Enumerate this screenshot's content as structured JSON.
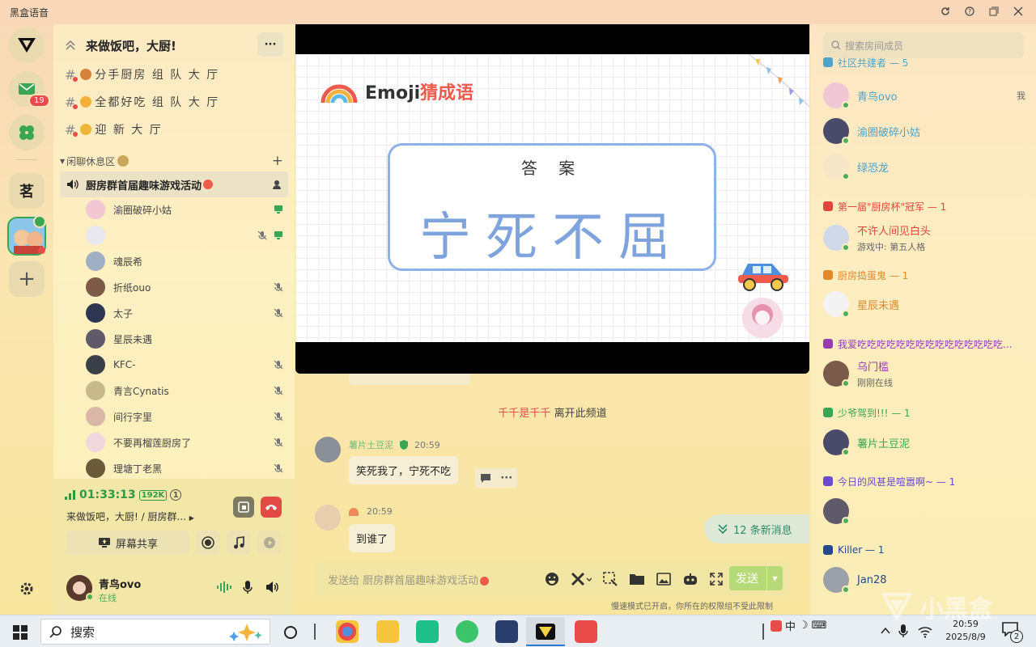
{
  "app": {
    "title": "黑盒语音"
  },
  "rail": {
    "mail_badge": "19",
    "tea_label": "茗",
    "add_label": "+"
  },
  "server": {
    "title": "来做饭吧，大厨!",
    "more_label": "···"
  },
  "text_channels": [
    {
      "name": "分手厨房 组 队 大 厅",
      "emoji_color": "#d7823a"
    },
    {
      "name": "全都好吃 组 队 大 厅",
      "emoji_color": "#f3b13a"
    },
    {
      "name": "迎 新 大 厅",
      "emoji_color": "#f0b437"
    }
  ],
  "group": {
    "name": "闲聊休息区",
    "add_label": "+"
  },
  "voice_channel": {
    "name": "厨房群首届趣味游戏活动"
  },
  "voice_members": [
    {
      "name": "渝圈破碎小姑",
      "muted": false,
      "color": "#f3c6d3"
    },
    {
      "name": "",
      "muted": true,
      "color": "#e8e8ee"
    },
    {
      "name": "魂辰希",
      "muted": false,
      "color": "#9fb0c4"
    },
    {
      "name": "折纸ouo",
      "muted": true,
      "color": "#7c5a45"
    },
    {
      "name": "太子",
      "muted": true,
      "color": "#2d3550"
    },
    {
      "name": "星辰未遇",
      "muted": false,
      "color": "#5e5a6a"
    },
    {
      "name": "KFC-",
      "muted": true,
      "color": "#3b4048"
    },
    {
      "name": "青言Cynatis",
      "muted": true,
      "color": "#c8b98a"
    },
    {
      "name": "间行字里",
      "muted": true,
      "color": "#d9b6a6"
    },
    {
      "name": "不要再榴莲厨房了",
      "muted": true,
      "color": "#f1d7de"
    },
    {
      "name": "理塘丁老黑",
      "muted": true,
      "color": "#6a5a3a"
    }
  ],
  "call": {
    "duration": "01:33:13",
    "bitrate": "192K",
    "count": "1",
    "channel": "来做饭吧，大厨! / 厨房群...",
    "screen_share_label": "屏幕共享"
  },
  "user": {
    "name": "青鸟ovo",
    "status": "在线"
  },
  "slide": {
    "logo_emoji": "Emoji",
    "logo_word": "猜成语",
    "answer_label": "答 案",
    "idiom": "宁死不屈"
  },
  "chat": {
    "system": {
      "user": "千千是千千",
      "text": "离开此频道"
    },
    "messages": [
      {
        "nick": "薯片土豆泥",
        "time": "20:59",
        "text": "笑死我了，宁死不吃"
      },
      {
        "nick": "",
        "time": "20:59",
        "text": "到谁了"
      }
    ],
    "new_messages": "12 条新消息",
    "input_placeholder": "发送给 厨房群首届趣味游戏活动",
    "send_label": "发送",
    "slow_mode": "慢速模式已开启，你所在的权限组不受此限制"
  },
  "members_panel": {
    "search_placeholder": "搜索房间成员",
    "top_partial_role": "社区共建者 — 5",
    "me_label": "我",
    "roles": [
      {
        "name": "第一届\"厨房杯\"冠军 — 1",
        "color": "#e0473a"
      },
      {
        "name": "厨房捣蛋鬼 — 1",
        "color": "#e0892f"
      },
      {
        "name": "我爱吃吃吃吃吃吃吃吃吃吃吃吃吃吃吃...",
        "color": "#9b3bb0"
      },
      {
        "name": "少爷驾到!!! — 1",
        "color": "#3aa655"
      },
      {
        "name": "今日的风甚是喧嚣啊~ — 1",
        "color": "#6a4bd0"
      },
      {
        "name": "Killer — 1",
        "color": "#224a8a"
      }
    ],
    "members": [
      {
        "name": "青鸟ovo",
        "color": "#4fa3c7"
      },
      {
        "name": "渝圈破碎小姑",
        "color": "#4fa3c7"
      },
      {
        "name": "绿恐龙",
        "color": "#4fa3c7"
      },
      {
        "name": "不许人间见白头",
        "color": "#e0473a",
        "sub": "游戏中: 第五人格"
      },
      {
        "name": "星辰未遇",
        "color": "#e0892f"
      },
      {
        "name": "乌门槛",
        "color": "#9b3bb0",
        "sub": "刚刚在线"
      },
      {
        "name": "薯片土豆泥",
        "color": "#3aa655"
      },
      {
        "name": "Jan28",
        "color": "#224a8a"
      }
    ]
  },
  "taskbar": {
    "search_label": "搜索",
    "ime": "中",
    "time": "20:59",
    "date": "2025/8/9",
    "notify_count": "2"
  },
  "watermark": "小黑盒"
}
